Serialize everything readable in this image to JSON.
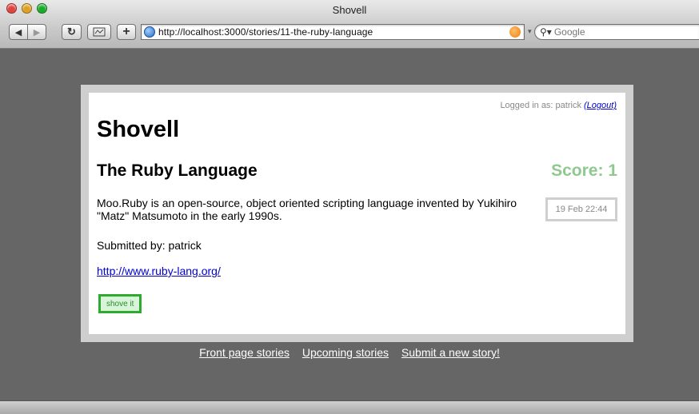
{
  "window": {
    "title": "Shovell"
  },
  "toolbar": {
    "back_icon": "◀",
    "forward_icon": "▶",
    "reload_icon": "↻",
    "add_icon": "+",
    "url": "http://localhost:3000/stories/11-the-ruby-language",
    "search_placeholder": "Google"
  },
  "page": {
    "login_text": "Logged in as: patrick",
    "logout_label": "(Logout)",
    "site_title": "Shovell",
    "story": {
      "title": "The Ruby Language",
      "score_label": "Score: 1",
      "description": "Moo.Ruby is an open-source, object oriented scripting language invented by Yukihiro \"Matz\" Matsumoto in the early 1990s.",
      "date": "19 Feb 22:44",
      "submitted_by": "Submitted by: patrick",
      "link": "http://www.ruby-lang.org/",
      "shove_label": "shove it"
    },
    "footer": {
      "front_page": "Front page stories",
      "upcoming": "Upcoming stories",
      "submit": "Submit a new story!"
    }
  },
  "colors": {
    "score": "#8fc98f",
    "shove_border": "#2eaa2e",
    "link": "#0000cc",
    "background": "#666666"
  }
}
